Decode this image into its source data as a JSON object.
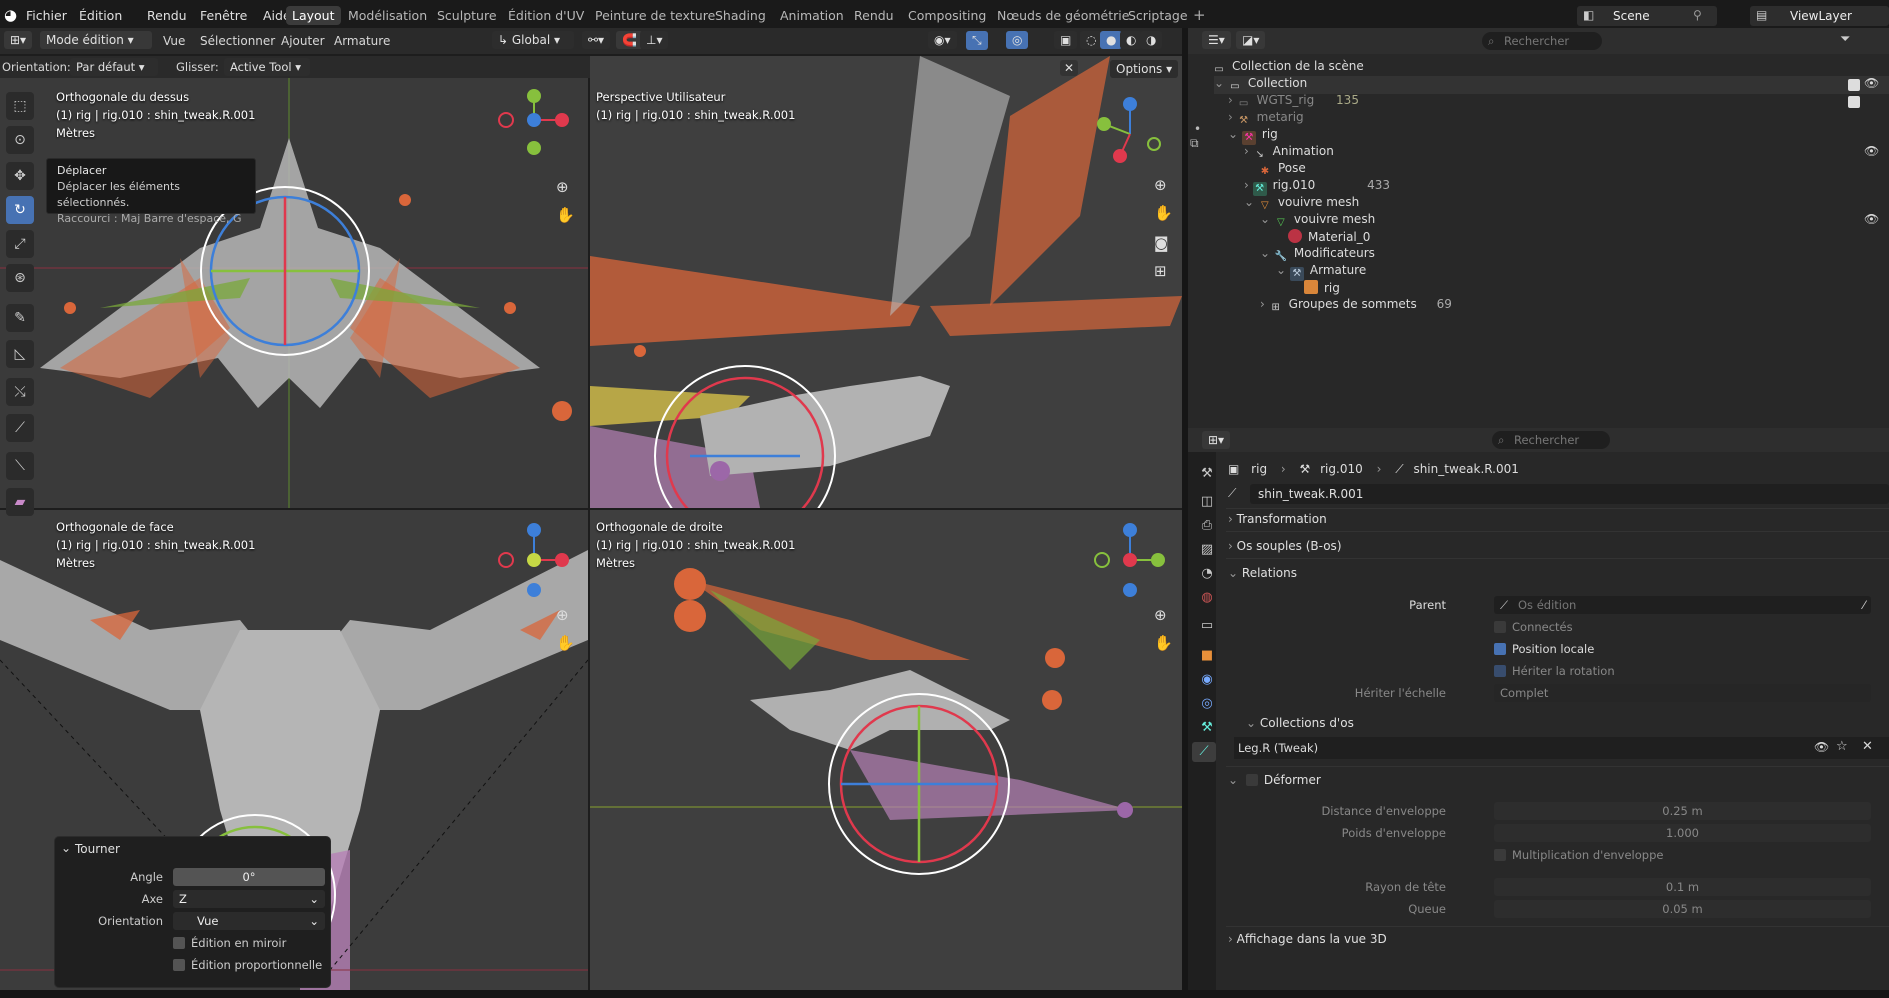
{
  "app_menu": {
    "file": "Fichier",
    "edit": "Édition",
    "render": "Rendu",
    "window": "Fenêtre",
    "help": "Aide"
  },
  "workspaces": [
    "Layout",
    "Modélisation",
    "Sculpture",
    "Édition d'UV",
    "Peinture de texture",
    "Shading",
    "Animation",
    "Rendu",
    "Compositing",
    "Nœuds de géométrie",
    "Scriptage"
  ],
  "scene": {
    "name": "Scene",
    "view_layer": "ViewLayer"
  },
  "viewport_header": {
    "mode": "Mode édition",
    "vue": "Vue",
    "select": "Sélectionner",
    "add": "Ajouter",
    "armature": "Armature",
    "transform": "Global"
  },
  "tool_header": {
    "orientation_label": "Orientation:",
    "orientation_value": "Par défaut",
    "drag_label": "Glisser:",
    "drag_value": "Active Tool",
    "options": "Options"
  },
  "tooltip": {
    "title": "Déplacer",
    "desc": "Déplacer les éléments sélectionnés.",
    "shortcut": "Raccourci : Maj Barre d'espace, G"
  },
  "views": {
    "top": {
      "name": "Orthogonale du dessus",
      "info": "(1) rig | rig.010 : shin_tweak.R.001",
      "units": "Mètres"
    },
    "persp": {
      "name": "Perspective Utilisateur",
      "info": "(1) rig | rig.010 : shin_tweak.R.001"
    },
    "front": {
      "name": "Orthogonale de face",
      "info": "(1) rig | rig.010 : shin_tweak.R.001",
      "units": "Mètres"
    },
    "right": {
      "name": "Orthogonale de droite",
      "info": "(1) rig | rig.010 : shin_tweak.R.001",
      "units": "Mètres"
    }
  },
  "rotate_panel": {
    "title": "Tourner",
    "angle_label": "Angle",
    "angle_value": "0°",
    "axis_label": "Axe",
    "axis_value": "Z",
    "orientation_label": "Orientation",
    "orientation_value": "Vue",
    "mirror": "Édition en miroir",
    "proportional": "Édition proportionnelle"
  },
  "outliner": {
    "search_placeholder": "Rechercher",
    "rows": [
      {
        "label": "Collection de la scène",
        "extra": ""
      },
      {
        "label": "Collection",
        "extra": ""
      },
      {
        "label": "WGTS_rig",
        "extra": "135"
      },
      {
        "label": "metarig",
        "extra": ""
      },
      {
        "label": "rig",
        "extra": ""
      },
      {
        "label": "Animation",
        "extra": ""
      },
      {
        "label": "Pose",
        "extra": ""
      },
      {
        "label": "rig.010",
        "extra": "433"
      },
      {
        "label": "vouivre mesh",
        "extra": ""
      },
      {
        "label": "vouivre mesh",
        "extra": ""
      },
      {
        "label": "Material_0",
        "extra": ""
      },
      {
        "label": "Modificateurs",
        "extra": ""
      },
      {
        "label": "Armature",
        "extra": ""
      },
      {
        "label": "rig",
        "extra": ""
      },
      {
        "label": "Groupes de sommets",
        "extra": "69"
      }
    ]
  },
  "properties": {
    "search_placeholder": "Rechercher",
    "breadcrumb": [
      "rig",
      "rig.010",
      "shin_tweak.R.001"
    ],
    "bone_name": "shin_tweak.R.001",
    "panels": {
      "transform": "Transformation",
      "bbone": "Os souples (B-os)",
      "relations": "Relations",
      "bone_collections": "Collections d'os",
      "deform": "Déformer",
      "viewport_display": "Affichage dans la vue 3D"
    },
    "parent_label": "Parent",
    "parent_placeholder": "Os édition",
    "connected": "Connectés",
    "local_location": "Position locale",
    "inherit_rotation": "Hériter la rotation",
    "inherit_scale_label": "Hériter l'échelle",
    "inherit_scale_value": "Complet",
    "collection_item": "Leg.R (Tweak)",
    "envelope_distance_label": "Distance d'enveloppe",
    "envelope_distance": "0.25 m",
    "envelope_weight_label": "Poids d'enveloppe",
    "envelope_weight": "1.000",
    "envelope_multiply": "Multiplication d'enveloppe",
    "head_radius_label": "Rayon de tête",
    "head_radius": "0.1 m",
    "tail_radius_label": "Queue",
    "tail_radius": "0.05 m"
  },
  "colors": {
    "accent": "#4772b3",
    "bone": "#d9663a",
    "axis_x": "#e0394d",
    "axis_y": "#87c03d",
    "axis_z": "#3d7fd9"
  }
}
